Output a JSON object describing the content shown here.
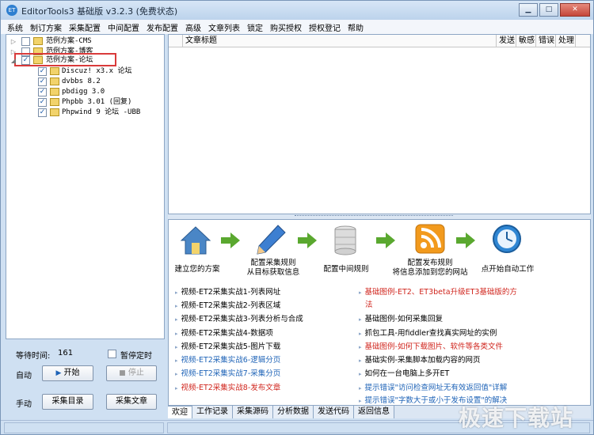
{
  "window": {
    "title": "EditorTools3 基础版 v3.2.3 (免费状态)",
    "app_icon_text": "ET",
    "minimize": "▁",
    "maximize": "□",
    "close": "✕"
  },
  "menu": [
    "系统",
    "制订方案",
    "采集配置",
    "中间配置",
    "发布配置",
    "高级",
    "文章列表",
    "锁定",
    "购买授权",
    "授权登记",
    "帮助"
  ],
  "tree": [
    {
      "label": "范例方案-CMS",
      "checked": false,
      "level": 0
    },
    {
      "label": "范例方案-博客",
      "checked": false,
      "level": 0
    },
    {
      "label": "范例方案-论坛",
      "checked": true,
      "level": 0
    },
    {
      "label": "Discuz! x3.x 论坛",
      "checked": true,
      "level": 1
    },
    {
      "label": "dvbbs 8.2",
      "checked": true,
      "level": 1
    },
    {
      "label": "pbdigg 3.0",
      "checked": true,
      "level": 1
    },
    {
      "label": "Phpbb 3.01 (回复)",
      "checked": true,
      "level": 1
    },
    {
      "label": "Phpwind 9 论坛 -UBB",
      "checked": true,
      "level": 1
    }
  ],
  "controls": {
    "wait_label": "等待时间:",
    "wait_value": "161",
    "pause_timer_label": "暂停定时",
    "auto_label": "自动",
    "start_button": "开始",
    "stop_button": "停止",
    "manual_label": "手动",
    "collect_dir_button": "采集目录",
    "collect_article_button": "采集文章"
  },
  "article_table": {
    "columns": [
      "文章标题",
      "发送",
      "敏感",
      "错误",
      "处理"
    ]
  },
  "steps": [
    {
      "label": "建立您的方案",
      "icon": "house-icon"
    },
    {
      "label": "配置采集规则\n从目标获取信息",
      "icon": "pencil-icon"
    },
    {
      "label": "配置中间规则",
      "icon": "database-icon"
    },
    {
      "label": "配置发布规则\n将信息添加到您的网站",
      "icon": "rss-icon"
    },
    {
      "label": "点开始自动工作",
      "icon": "clock-icon"
    }
  ],
  "links_left": [
    {
      "text": "视频-ET2采集实战1-列表网址",
      "color": "black"
    },
    {
      "text": "视频-ET2采集实战2-列表区域",
      "color": "black"
    },
    {
      "text": "视频-ET2采集实战3-列表分析与合成",
      "color": "black"
    },
    {
      "text": "视频-ET2采集实战4-数据项",
      "color": "black"
    },
    {
      "text": "视频-ET2采集实战5-图片下载",
      "color": "black"
    },
    {
      "text": "视频-ET2采集实战6-逻辑分页",
      "color": "blue"
    },
    {
      "text": "视频-ET2采集实战7-采集分页",
      "color": "blue"
    },
    {
      "text": "视频-ET2采集实战8-发布文章",
      "color": "red"
    }
  ],
  "links_right": [
    {
      "text": "基础图例-ET2、ET3beta升级ET3基础版的方",
      "cont": "法",
      "color": "red"
    },
    {
      "text": "基础图例-如何采集回复",
      "color": "black"
    },
    {
      "text": "抓包工具-用fiddler查找真实网址的实例",
      "color": "black"
    },
    {
      "text": "基础图例-如何下载图片、软件等各类文件",
      "color": "red"
    },
    {
      "text": "基础实例-采集脚本加载内容的网页",
      "color": "black"
    },
    {
      "text": "如何在一台电脑上多开ET",
      "color": "black"
    },
    {
      "text": "提示错误\"访问检查网址无有效返回值\"详解",
      "color": "blue"
    },
    {
      "text": "提示错误\"字数大于或小于发布设置\"的解决",
      "color": "blue"
    }
  ],
  "tabs": [
    "欢迎",
    "工作记录",
    "采集源码",
    "分析数据",
    "发送代码",
    "返回信息"
  ],
  "watermark": "极速下载站",
  "colors": {
    "accent_red": "#d93a3a",
    "link_blue": "#1e63b7",
    "link_red": "#d0251d",
    "arrow_green": "#5aa82f",
    "rss_orange": "#f29a1d"
  }
}
